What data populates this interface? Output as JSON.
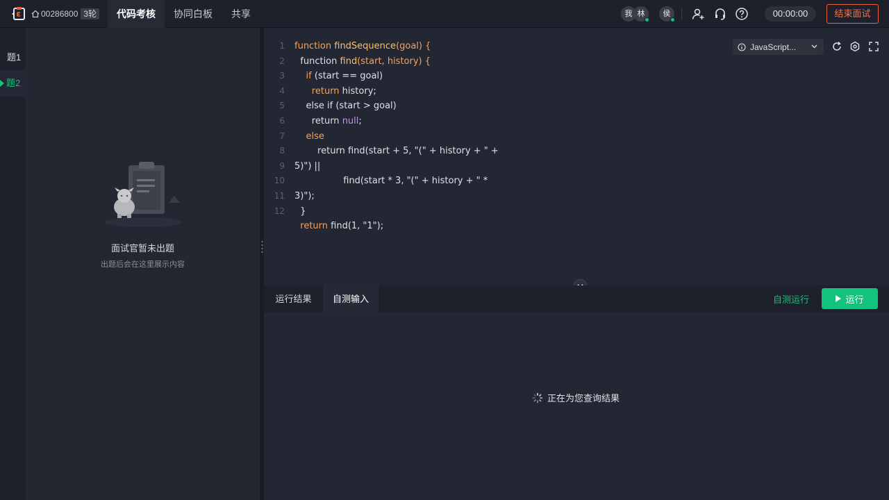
{
  "header": {
    "room_id": "00286800",
    "round_badge": "3轮",
    "tabs": [
      {
        "label": "代码考核",
        "active": true
      },
      {
        "label": "协同白板",
        "active": false
      },
      {
        "label": "共享",
        "active": false
      }
    ],
    "participants": [
      {
        "initial": "我",
        "online": false
      },
      {
        "initial": "林",
        "online": true
      },
      {
        "initial": "侯",
        "online": true
      }
    ],
    "icons": [
      "invite-user-icon",
      "headset-icon",
      "help-icon"
    ],
    "timer": "00:00:00",
    "end_button": "结束面试"
  },
  "questions": {
    "items": [
      {
        "label": "题1",
        "active": false
      },
      {
        "label": "题2",
        "active": true
      }
    ]
  },
  "problem_panel": {
    "empty_title": "面试官暂未出题",
    "empty_subtitle": "出题后会在这里展示内容"
  },
  "editor": {
    "language": "JavaScript...",
    "line_numbers": [
      "1",
      "2",
      "3",
      "4",
      "5",
      "6",
      "7",
      "8",
      "9",
      "10",
      "11",
      "12"
    ],
    "tools": [
      "refresh-icon",
      "settings-icon",
      "fullscreen-icon"
    ]
  },
  "result": {
    "tabs": [
      {
        "label": "运行结果",
        "active": false
      },
      {
        "label": "自测输入",
        "active": true
      }
    ],
    "self_test_label": "自测运行",
    "run_label": "运行",
    "loading_text": "正在为您查询结果"
  },
  "colors": {
    "accent_green": "#13c27c",
    "end_orange": "#f07448",
    "keyword": "#f4a45c",
    "null_literal": "#c792ea"
  }
}
